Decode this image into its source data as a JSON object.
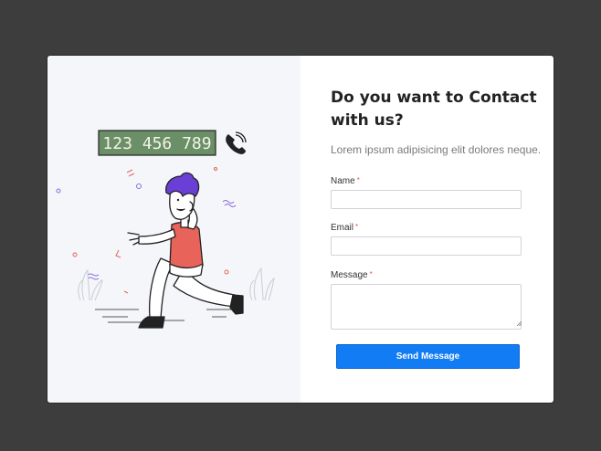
{
  "panel": {
    "phone_number": "123 456 789",
    "title": "Do you want to Contact with us?",
    "subtitle": "Lorem ipsum adipisicing elit dolores neque."
  },
  "form": {
    "name_label": "Name",
    "email_label": "Email",
    "message_label": "Message",
    "required_mark": "*",
    "name_value": "",
    "email_value": "",
    "message_value": "",
    "submit_label": "Send Message"
  },
  "colors": {
    "background": "#3d3d3d",
    "card": "#ffffff",
    "illustration_bg": "#f5f6fa",
    "accent": "#127cf5",
    "required": "#e05a5a",
    "sign_green": "#6b8f66",
    "shirt": "#e8635a",
    "hair": "#6a3fd6"
  },
  "icons": [
    "phone-icon",
    "resize-handle-icon"
  ]
}
